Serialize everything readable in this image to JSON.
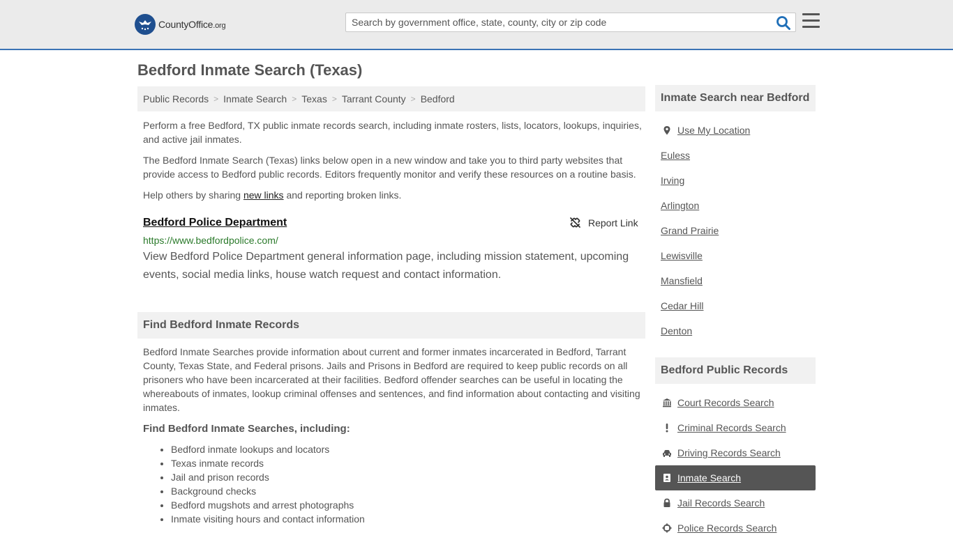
{
  "header": {
    "logo_brand": "CountyOffice",
    "logo_tld": ".org",
    "search_placeholder": "Search by government office, state, county, city or zip code"
  },
  "page": {
    "title": "Bedford Inmate Search (Texas)"
  },
  "breadcrumb": [
    "Public Records",
    "Inmate Search",
    "Texas",
    "Tarrant County",
    "Bedford"
  ],
  "intro": {
    "p1": "Perform a free Bedford, TX public inmate records search, including inmate rosters, lists, locators, lookups, inquiries, and active jail inmates.",
    "p2": "The Bedford Inmate Search (Texas) links below open in a new window and take you to third party websites that provide access to Bedford public records. Editors frequently monitor and verify these resources on a routine basis.",
    "p3_before": "Help others by sharing ",
    "p3_link": "new links",
    "p3_after": " and reporting broken links."
  },
  "result": {
    "title": "Bedford Police Department",
    "report_label": "Report Link",
    "url": "https://www.bedfordpolice.com/",
    "description": "View Bedford Police Department general information page, including mission statement, upcoming events, social media links, house watch request and contact information."
  },
  "find_section": {
    "heading": "Find Bedford Inmate Records",
    "body": "Bedford Inmate Searches provide information about current and former inmates incarcerated in Bedford, Tarrant County, Texas State, and Federal prisons. Jails and Prisons in Bedford are required to keep public records on all prisoners who have been incarcerated at their facilities. Bedford offender searches can be useful in locating the whereabouts of inmates, lookup criminal offenses and sentences, and find information about contacting and visiting inmates.",
    "subheading": "Find Bedford Inmate Searches, including:",
    "items": [
      "Bedford inmate lookups and locators",
      "Texas inmate records",
      "Jail and prison records",
      "Background checks",
      "Bedford mugshots and arrest photographs",
      "Inmate visiting hours and contact information"
    ]
  },
  "sidebar": {
    "nearby_heading": "Inmate Search near Bedford",
    "use_location": "Use My Location",
    "nearby": [
      "Euless",
      "Irving",
      "Arlington",
      "Grand Prairie",
      "Lewisville",
      "Mansfield",
      "Cedar Hill",
      "Denton"
    ],
    "records_heading": "Bedford Public Records",
    "records": [
      {
        "label": "Court Records Search",
        "icon": "courthouse-icon"
      },
      {
        "label": "Criminal Records Search",
        "icon": "exclamation-icon"
      },
      {
        "label": "Driving Records Search",
        "icon": "car-icon"
      },
      {
        "label": "Inmate Search",
        "icon": "inmate-badge-icon"
      },
      {
        "label": "Jail Records Search",
        "icon": "lock-icon"
      },
      {
        "label": "Police Records Search",
        "icon": "crosshair-icon"
      }
    ]
  },
  "colors": {
    "header_bg": "#ebebeb",
    "header_border": "#3a73b5",
    "logo_blue": "#1f4f8f",
    "search_icon": "#1f6fb8",
    "url_green": "#2b7a2b",
    "active_item_bg": "#555555"
  }
}
